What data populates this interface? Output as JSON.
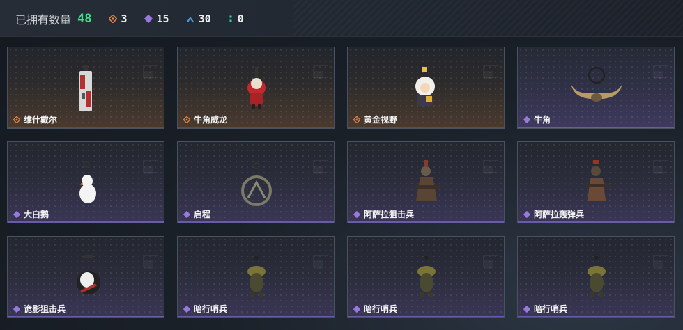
{
  "header": {
    "owned_label": "已拥有数量",
    "owned_count": "48",
    "stats": [
      {
        "icon": "orange-diamond-icon",
        "value": "3",
        "color": "#e0804a"
      },
      {
        "icon": "purple-diamond-icon",
        "value": "15",
        "color": "#9b7ae0"
      },
      {
        "icon": "blue-chevron-icon",
        "value": "30",
        "color": "#4aa0e0"
      },
      {
        "icon": "green-dots-icon",
        "value": "0",
        "color": "#3ad0a0"
      }
    ]
  },
  "items": [
    {
      "name": "维什戴尔",
      "rarity": "orange",
      "icon": "figure-red-white-charm"
    },
    {
      "name": "牛角威龙",
      "rarity": "orange",
      "icon": "figure-red-knight-charm"
    },
    {
      "name": "黄金视野",
      "rarity": "orange",
      "icon": "figure-white-hair-charm"
    },
    {
      "name": "牛角",
      "rarity": "purple",
      "icon": "horn-necklace"
    },
    {
      "name": "大白鹅",
      "rarity": "purple",
      "icon": "white-goose-charm"
    },
    {
      "name": "启程",
      "rarity": "purple",
      "icon": "ring-pendant"
    },
    {
      "name": "阿萨拉狙击兵",
      "rarity": "purple",
      "icon": "soldier-figure"
    },
    {
      "name": "阿萨拉轰弹兵",
      "rarity": "purple",
      "icon": "soldier-figure"
    },
    {
      "name": "诡影狙击兵",
      "rarity": "purple",
      "icon": "white-mask-figure"
    },
    {
      "name": "暗行哨兵",
      "rarity": "purple",
      "icon": "camo-creature-charm"
    },
    {
      "name": "暗行哨兵",
      "rarity": "purple",
      "icon": "camo-creature-charm"
    },
    {
      "name": "暗行哨兵",
      "rarity": "purple",
      "icon": "camo-creature-charm"
    }
  ],
  "colors": {
    "owned": "#39e08a",
    "orange": "#e0804a",
    "purple": "#9b7ae0"
  }
}
